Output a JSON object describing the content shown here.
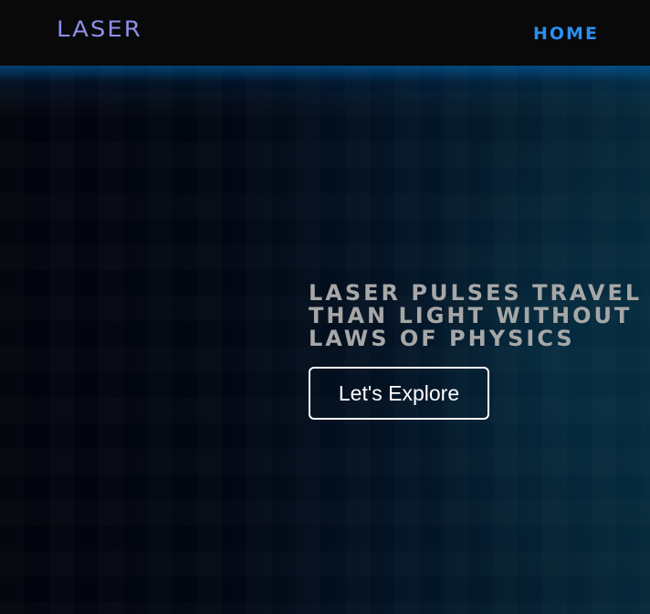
{
  "navbar": {
    "logo": "LASER",
    "links": [
      {
        "label": "HOME"
      }
    ]
  },
  "hero": {
    "headline_lines": [
      "LASER PULSES TRAVEL",
      "THAN LIGHT WITHOUT",
      "LAWS OF PHYSICS"
    ],
    "cta_label": "Let's Explore"
  },
  "colors": {
    "navbar_bg": "#090909",
    "logo": "#8e8fe6",
    "nav_link": "#2b8ff0",
    "headline": "#a7a7a7",
    "hero_left": "#02040c",
    "hero_right": "#05283a",
    "button_border": "#ffffff"
  }
}
